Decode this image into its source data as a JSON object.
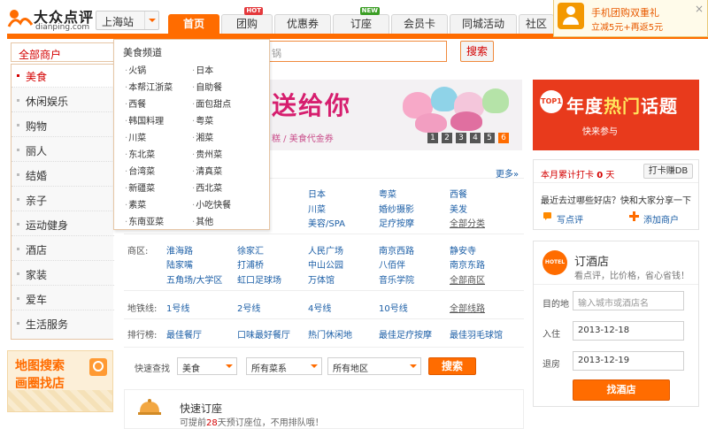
{
  "logo": {
    "name_cn": "大众点评",
    "name_en": "dianping.com"
  },
  "city": {
    "label": "上海站"
  },
  "nav": {
    "tabs": [
      {
        "label": "首页",
        "active": true
      },
      {
        "label": "团购",
        "badge": "HOT",
        "badge_color": "#e4393c"
      },
      {
        "label": "优惠券"
      },
      {
        "label": "订座",
        "badge": "NEW",
        "badge_color": "#3a9d23"
      },
      {
        "label": "会员卡"
      },
      {
        "label": "同城活动"
      },
      {
        "label": "社区"
      }
    ]
  },
  "promo": {
    "line1": "手机团购双重礼",
    "line2": "立减5元+再返5元",
    "close": "×"
  },
  "search": {
    "placeholder": "锅",
    "button": "搜索"
  },
  "categories": {
    "title": "全部商户",
    "items": [
      "美食",
      "休闲娱乐",
      "购物",
      "丽人",
      "结婚",
      "亲子",
      "运动健身",
      "酒店",
      "家装",
      "爱车",
      "生活服务"
    ],
    "active_index": 0
  },
  "food_panel": {
    "title": "美食频道",
    "col1": [
      "火锅",
      "本帮江浙菜",
      "西餐",
      "韩国料理",
      "川菜",
      "东北菜",
      "台湾菜",
      "新疆菜",
      "素菜",
      "东南亚菜"
    ],
    "col2": [
      "日本",
      "自助餐",
      "面包甜点",
      "粤菜",
      "湘菜",
      "贵州菜",
      "清真菜",
      "西北菜",
      "小吃快餐",
      "其他"
    ]
  },
  "banner": {
    "headline": "送给你",
    "sub": "糕  /  美食代金券",
    "pages": [
      "1",
      "2",
      "3",
      "4",
      "5",
      "6"
    ],
    "active_page": "6"
  },
  "ad_hot": {
    "badge": "TOP1",
    "title_a": "年度",
    "title_b": "热门",
    "title_c": "话题",
    "sub": "快来参与"
  },
  "main": {
    "more": "更多»",
    "top_links": [
      [
        "日本",
        "粤菜",
        "西餐"
      ],
      [
        "川菜",
        "婚纱摄影",
        "美发"
      ],
      [
        "美容/SPA",
        "足疗按摩",
        "全部分类"
      ]
    ],
    "districts": {
      "label": "商区:",
      "rows": [
        [
          "淮海路",
          "徐家汇",
          "人民广场",
          "南京西路",
          "静安寺"
        ],
        [
          "陆家嘴",
          "打浦桥",
          "中山公园",
          "八佰伴",
          "南京东路"
        ],
        [
          "五角场/大学区",
          "虹口足球场",
          "万体馆",
          "音乐学院",
          "全部商区"
        ]
      ]
    },
    "metro": {
      "label": "地铁线:",
      "items": [
        "1号线",
        "2号线",
        "4号线",
        "10号线",
        "全部线路"
      ]
    },
    "ranking": {
      "label": "排行榜:",
      "items": [
        "最佳餐厅",
        "口味最好餐厅",
        "热门休闲地",
        "最佳足疗按摩",
        "最佳羽毛球馆"
      ]
    },
    "quick_search": {
      "label": "快速查找",
      "cuisine": "美食",
      "subtype": "所有菜系",
      "area": "所有地区",
      "button": "搜索"
    },
    "booking": {
      "title": "快速订座",
      "desc_pre": "可提前",
      "desc_num": "28",
      "desc_post": "天预订座位，不用排队哦！"
    }
  },
  "checkin": {
    "title_pre": "本月累计打卡",
    "days": "0",
    "title_post": "天",
    "button": "打卡赚DB",
    "ask": "最近去过哪些好店？快和大家分享一下",
    "review": "写点评",
    "add": "添加商户"
  },
  "hotel": {
    "badge": "HOTEL",
    "title": "订酒店",
    "sub": "看点评，比价格，省心省钱！",
    "dest_label": "目的地",
    "dest_placeholder": "输入城市或酒店名",
    "in_label": "入住",
    "in_value": "2013-12-18",
    "out_label": "退房",
    "out_value": "2013-12-19",
    "button": "找酒店"
  },
  "map_box": {
    "line1": "地图搜索",
    "line2": "画圈找店"
  }
}
